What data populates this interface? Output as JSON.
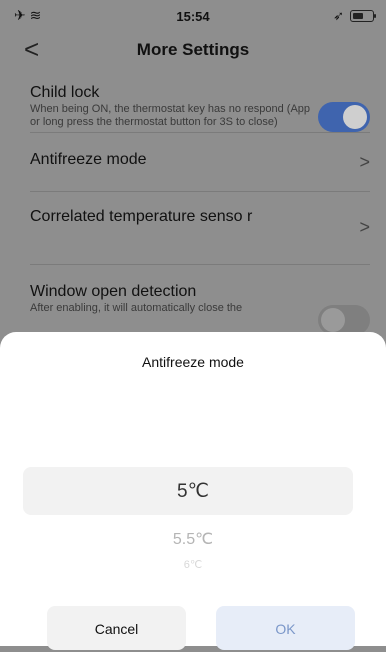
{
  "status_bar": {
    "time": "15:54",
    "left_icons": "✈ ≋"
  },
  "nav": {
    "back_glyph": "<",
    "title": "More Settings"
  },
  "settings": {
    "child_lock": {
      "title": "Child lock",
      "description": "When being ON, the thermostat key has no respond (App or long press the thermostat button for 3S to close)",
      "enabled": true
    },
    "antifreeze": {
      "title": "Antifreeze mode",
      "chevron": ">"
    },
    "correlated_sensor": {
      "title": "Correlated temperature senso r",
      "chevron": ">"
    },
    "window_open": {
      "title": "Window open detection",
      "description": "After enabling, it will automatically close the",
      "enabled": false
    }
  },
  "sheet": {
    "title": "Antifreeze mode",
    "options": [
      "5℃",
      "5.5℃",
      "6℃"
    ],
    "selected": "5℃",
    "cancel_label": "Cancel",
    "ok_label": "OK"
  },
  "colors": {
    "accent": "#3f64ae",
    "ok_text": "#7b97c9"
  }
}
